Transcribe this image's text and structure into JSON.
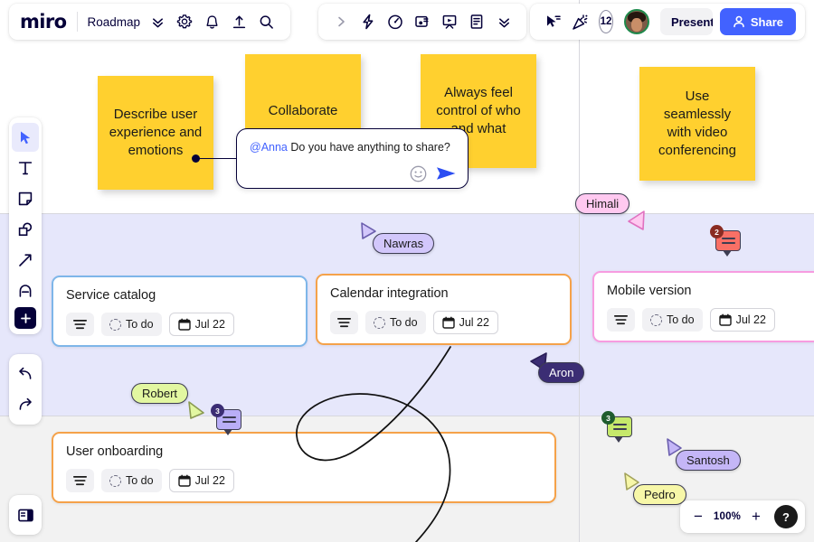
{
  "app": {
    "logo": "miro",
    "board_name": "Roadmap"
  },
  "toolbar_left_icons": [
    {
      "name": "board-menu-chevron",
      "glyph": "chevrons-down"
    },
    {
      "name": "settings-gear-icon",
      "glyph": "gear"
    },
    {
      "name": "notifications-bell-icon",
      "glyph": "bell"
    },
    {
      "name": "upload-export-icon",
      "glyph": "upload"
    },
    {
      "name": "search-icon",
      "glyph": "magnifier"
    }
  ],
  "toolbar_center_icons": [
    {
      "name": "expand-right-icon",
      "glyph": "chevron-right"
    },
    {
      "name": "lightning-apps-icon",
      "glyph": "bolt"
    },
    {
      "name": "timer-icon",
      "glyph": "timer"
    },
    {
      "name": "video-chat-icon",
      "glyph": "video-card"
    },
    {
      "name": "presentation-icon",
      "glyph": "easel"
    },
    {
      "name": "notes-document-icon",
      "glyph": "document"
    },
    {
      "name": "more-tools-chevron",
      "glyph": "chevrons-down"
    }
  ],
  "toolbar_right": {
    "cursor_share_icon": "cursor-lines",
    "celebrate_icon": "party-popper",
    "collaborator_count": "12",
    "avatar_name": "avatar",
    "present_label": "Present",
    "share_label": "Share"
  },
  "left_tools": [
    {
      "name": "select-tool",
      "glyph": "cursor",
      "active": true
    },
    {
      "name": "text-tool",
      "glyph": "T",
      "active": false
    },
    {
      "name": "sticky-note-tool",
      "glyph": "note",
      "active": false
    },
    {
      "name": "shapes-tool",
      "glyph": "shapes",
      "active": false
    },
    {
      "name": "connector-arrow-tool",
      "glyph": "arrow",
      "active": false
    },
    {
      "name": "pen-tool",
      "glyph": "pen",
      "active": false
    },
    {
      "name": "add-more-tool",
      "glyph": "plus",
      "active": false
    }
  ],
  "history_tools": [
    {
      "name": "undo-button",
      "glyph": "undo"
    },
    {
      "name": "redo-button",
      "glyph": "redo"
    }
  ],
  "panel_tool": {
    "name": "toggle-panel-button",
    "glyph": "panel"
  },
  "sticky_notes": [
    {
      "id": "describe",
      "text": "Describe user experience and emotions",
      "color": "#ffd02f"
    },
    {
      "id": "collaborate",
      "text": "Collaborate",
      "color": "#ffd02f"
    },
    {
      "id": "control",
      "text": "Always feel control of who and what",
      "color": "#ffd02f"
    },
    {
      "id": "video",
      "text": "Use seamlessly with video conferencing",
      "color": "#ffd02f"
    }
  ],
  "comment_composer": {
    "mention": "@Anna",
    "message": " Do you have anything to share?",
    "emoji_icon": "smiley-icon",
    "send_icon": "send-arrow-icon"
  },
  "cards": [
    {
      "id": "service",
      "title": "Service catalog",
      "status": "To do",
      "date": "Jul 22",
      "border": "#7eb6e9"
    },
    {
      "id": "calendar",
      "title": "Calendar integration",
      "status": "To do",
      "date": "Jul 22",
      "border": "#f5a24a"
    },
    {
      "id": "mobile",
      "title": "Mobile version",
      "status": "To do",
      "date": "Jul 22",
      "border": "#f79ce0"
    },
    {
      "id": "user",
      "title": "User onboarding",
      "status": "To do",
      "date": "Jul 22",
      "border": "#f5a24a"
    }
  ],
  "cursors": [
    {
      "name": "Himali",
      "fill": "#ffc9f0",
      "text": "#1a1a1a"
    },
    {
      "name": "Nawras",
      "fill": "#d2c7fb",
      "text": "#1a1a1a"
    },
    {
      "name": "Aron",
      "fill": "#3b2d74",
      "text": "#ffffff"
    },
    {
      "name": "Robert",
      "fill": "#e2f7a1",
      "text": "#1a1a1a"
    },
    {
      "name": "Santosh",
      "fill": "#c4b6f7",
      "text": "#1a1a1a"
    },
    {
      "name": "Pedro",
      "fill": "#f7f7a8",
      "text": "#1a1a1a"
    }
  ],
  "comment_pins": [
    {
      "id": "pin-red",
      "count": "2",
      "fill": "#f97066",
      "badge": "#8a2b22"
    },
    {
      "id": "pin-purple",
      "count": "3",
      "fill": "#b9aef7",
      "badge": "#3b2d74"
    },
    {
      "id": "pin-green",
      "count": "3",
      "fill": "#c6e96b",
      "badge": "#1f5c2e"
    }
  ],
  "zoom_controls": {
    "zoom_out_label": "−",
    "level": "100%",
    "zoom_in_label": "+",
    "help_label": "?"
  }
}
